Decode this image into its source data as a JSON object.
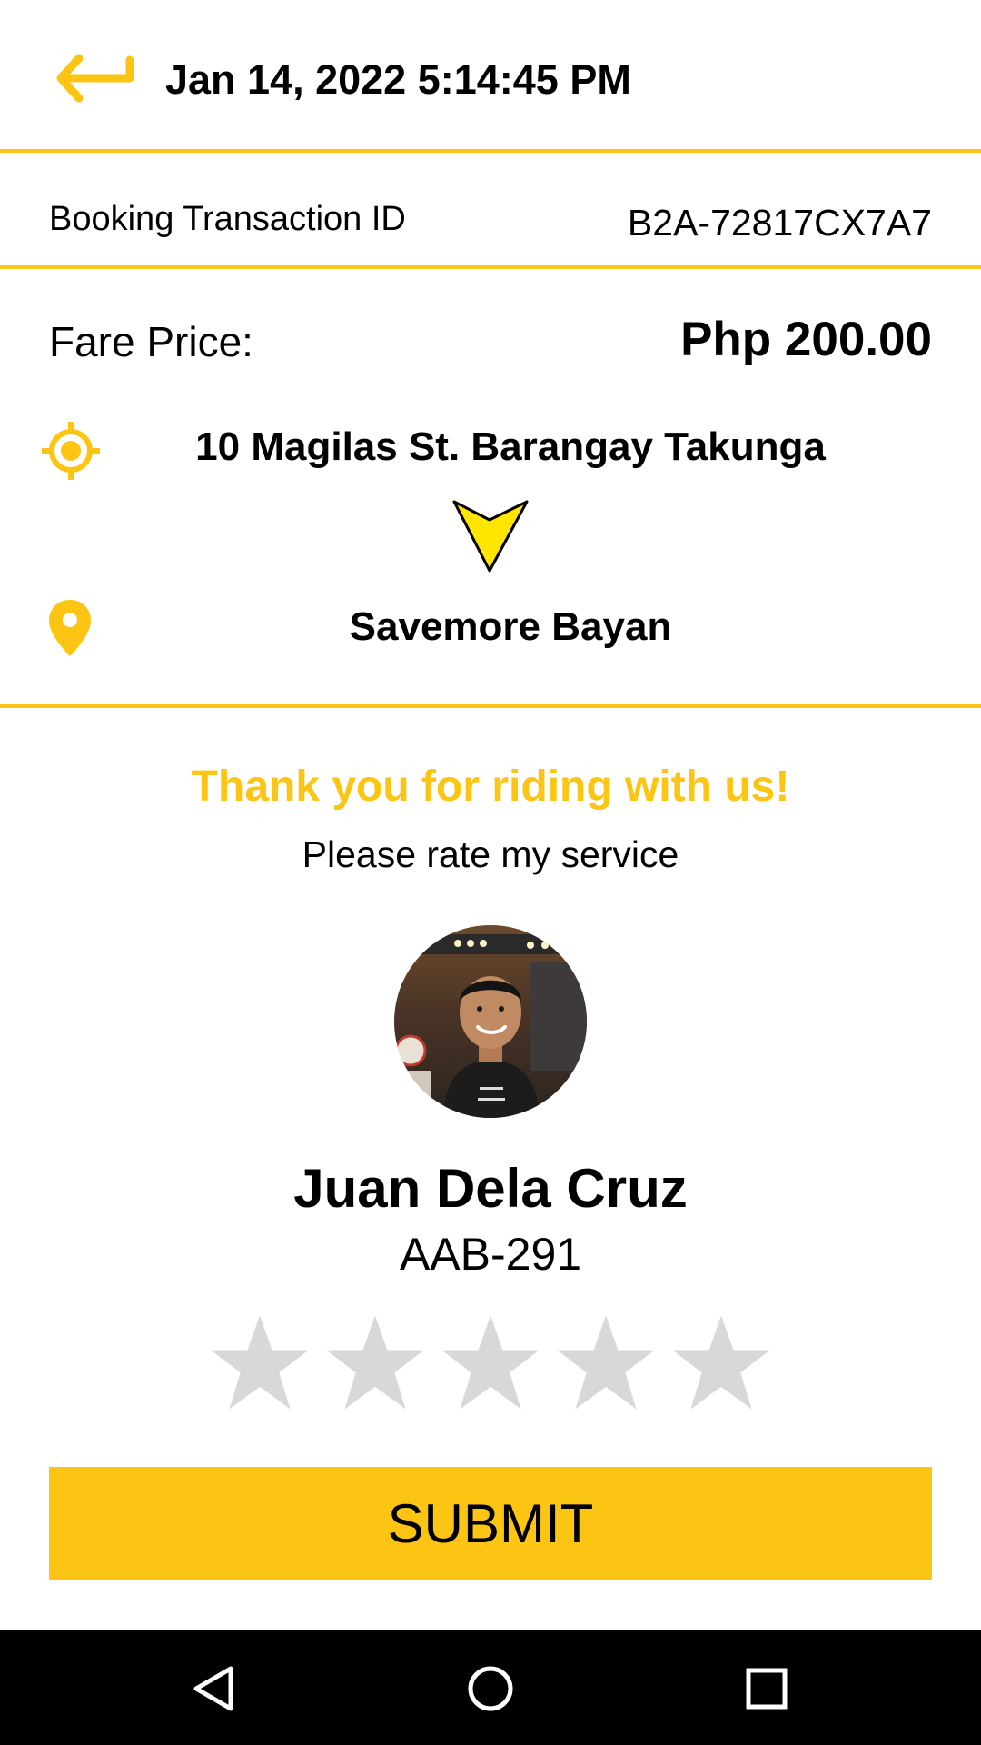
{
  "header": {
    "back_icon": "back-arrow-icon",
    "datetime": "Jan 14, 2022 5:14:45 PM"
  },
  "transaction": {
    "label": "Booking Transaction ID",
    "id": "B2A-72817CX7A7"
  },
  "fare": {
    "label": "Fare Price:",
    "value": "Php 200.00"
  },
  "route": {
    "pickup_icon": "crosshair-target-icon",
    "pickup": "10 Magilas St. Barangay Takunga",
    "direction_icon": "arrow-down-icon",
    "dropoff_icon": "map-pin-icon",
    "dropoff": "Savemore Bayan"
  },
  "rating": {
    "thank_you": "Thank you for riding with us!",
    "prompt": "Please rate my service",
    "driver_name": "Juan Dela Cruz",
    "plate_number": "AAB-291",
    "max_stars": 5,
    "selected_stars": 0,
    "star_icon": "star-icon"
  },
  "submit_label": "SUBMIT",
  "nav_bar": {
    "back_icon": "triangle-back-icon",
    "home_icon": "circle-home-icon",
    "recents_icon": "square-recents-icon"
  },
  "colors": {
    "accent": "#fcc514",
    "star_empty": "#d8d8d8",
    "nav_background": "#000000"
  }
}
